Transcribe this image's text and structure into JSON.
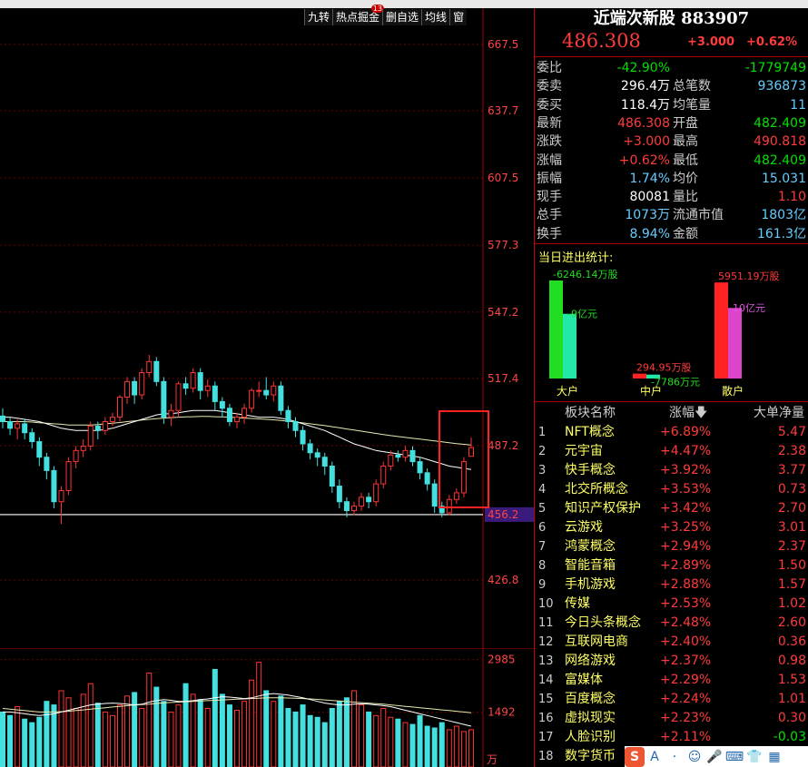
{
  "toolbar": {
    "jiuzhuan": "九转",
    "hotspot": "热点掘金",
    "hotspot_badge": "13",
    "delete_select": "删自选",
    "ma_line": "均线",
    "window": "窗"
  },
  "price_axis": [
    "667.5",
    "637.7",
    "607.5",
    "577.3",
    "547.2",
    "517.4",
    "487.2",
    "456.2",
    "426.8"
  ],
  "volume_axis": [
    "2985",
    "1492"
  ],
  "volume_unit": "万",
  "stock": {
    "name": "近端次新股",
    "code": "883907",
    "price": "486.308",
    "change": "+3.000",
    "pct": "+0.62%"
  },
  "quote_rows": [
    {
      "l1": "委比",
      "v1": "-42.90%",
      "c1": "green",
      "l2": "",
      "v2": "-1779749",
      "c2": "green"
    },
    {
      "l1": "委卖",
      "v1": "296.4万",
      "c1": "white",
      "l2": "总笔数",
      "v2": "936873",
      "c2": "cyan"
    },
    {
      "l1": "委买",
      "v1": "118.4万",
      "c1": "white",
      "l2": "均笔量",
      "v2": "11",
      "c2": "cyan"
    },
    {
      "l1": "最新",
      "v1": "486.308",
      "c1": "red",
      "l2": "开盘",
      "v2": "482.409",
      "c2": "green"
    },
    {
      "l1": "涨跌",
      "v1": "+3.000",
      "c1": "red",
      "l2": "最高",
      "v2": "490.818",
      "c2": "red"
    },
    {
      "l1": "涨幅",
      "v1": "+0.62%",
      "c1": "red",
      "l2": "最低",
      "v2": "482.409",
      "c2": "green"
    },
    {
      "l1": "振幅",
      "v1": "1.74%",
      "c1": "cyan",
      "l2": "均价",
      "v2": "15.031",
      "c2": "cyan"
    },
    {
      "l1": "现手",
      "v1": "80081",
      "c1": "white",
      "l2": "量比",
      "v2": "1.10",
      "c2": "red"
    },
    {
      "l1": "总手",
      "v1": "1073万",
      "c1": "cyan",
      "l2": "流通市值",
      "v2": "1803亿",
      "c2": "cyan"
    },
    {
      "l1": "换手",
      "v1": "8.94%",
      "c1": "cyan",
      "l2": "金额",
      "v2": "161.3亿",
      "c2": "cyan"
    }
  ],
  "flow": {
    "title": "当日进出统计:",
    "groups": [
      {
        "label": "大户",
        "vol_label": "-6246.14万股",
        "amt_label": "-9亿元",
        "vol_frac": 1.0,
        "amt_frac": 0.66,
        "vol_color": "#22dd22",
        "amt_color": "#22e8a8",
        "vol_text_color": "#22dd22",
        "amt_text_color": "#22dd22"
      },
      {
        "label": "中户",
        "vol_label": "294.95万股",
        "amt_label": "-7786万元",
        "vol_frac": 0.05,
        "amt_frac": 0.04,
        "vol_color": "#ff2222",
        "amt_color": "#22e8a8",
        "vol_text_color": "#ff3b3b",
        "amt_text_color": "#22dd22"
      },
      {
        "label": "散户",
        "vol_label": "5951.19万股",
        "amt_label": "10亿元",
        "vol_frac": 0.98,
        "amt_frac": 0.72,
        "vol_color": "#ff2222",
        "amt_color": "#dd44cc",
        "vol_text_color": "#ff3b3b",
        "amt_text_color": "#dd55dd"
      }
    ]
  },
  "sectors": {
    "h_name": "板块名称",
    "h_pct": "涨幅",
    "h_net": "大单净量",
    "rows": [
      {
        "idx": "1",
        "name": "NFT概念",
        "pct": "+6.89%",
        "net": "5.47",
        "neg": false
      },
      {
        "idx": "2",
        "name": "元宇宙",
        "pct": "+4.47%",
        "net": "2.38",
        "neg": false
      },
      {
        "idx": "3",
        "name": "快手概念",
        "pct": "+3.92%",
        "net": "3.77",
        "neg": false
      },
      {
        "idx": "4",
        "name": "北交所概念",
        "pct": "+3.53%",
        "net": "0.73",
        "neg": false
      },
      {
        "idx": "5",
        "name": "知识产权保护",
        "pct": "+3.42%",
        "net": "2.70",
        "neg": false
      },
      {
        "idx": "6",
        "name": "云游戏",
        "pct": "+3.25%",
        "net": "3.01",
        "neg": false
      },
      {
        "idx": "7",
        "name": "鸿蒙概念",
        "pct": "+2.94%",
        "net": "2.37",
        "neg": false
      },
      {
        "idx": "8",
        "name": "智能音箱",
        "pct": "+2.89%",
        "net": "1.50",
        "neg": false
      },
      {
        "idx": "9",
        "name": "手机游戏",
        "pct": "+2.88%",
        "net": "1.57",
        "neg": false
      },
      {
        "idx": "10",
        "name": "传媒",
        "pct": "+2.53%",
        "net": "1.02",
        "neg": false
      },
      {
        "idx": "11",
        "name": "今日头条概念",
        "pct": "+2.48%",
        "net": "2.60",
        "neg": false
      },
      {
        "idx": "12",
        "name": "互联网电商",
        "pct": "+2.40%",
        "net": "0.36",
        "neg": false
      },
      {
        "idx": "13",
        "name": "网络游戏",
        "pct": "+2.37%",
        "net": "0.98",
        "neg": false
      },
      {
        "idx": "14",
        "name": "富媒体",
        "pct": "+2.29%",
        "net": "1.53",
        "neg": false
      },
      {
        "idx": "15",
        "name": "百度概念",
        "pct": "+2.24%",
        "net": "1.01",
        "neg": false
      },
      {
        "idx": "16",
        "name": "虚拟现实",
        "pct": "+2.23%",
        "net": "0.30",
        "neg": false
      },
      {
        "idx": "17",
        "name": "人脸识别",
        "pct": "+2.11%",
        "net": "-0.03",
        "neg": true
      },
      {
        "idx": "18",
        "name": "数字货币",
        "pct": "",
        "net": "",
        "neg": false
      }
    ]
  },
  "ime": {
    "s": "S",
    "a": "A",
    "dot": "·"
  },
  "chart_data": {
    "type": "candlestick",
    "y_ticks": [
      667.5,
      637.7,
      607.5,
      577.3,
      547.2,
      517.4,
      487.2,
      456.2,
      426.8
    ],
    "highlight_level": 456.2,
    "ylim": [
      420.0,
      680.0
    ],
    "candles": [
      [
        500.5,
        498,
        504,
        495
      ],
      [
        498,
        495,
        500,
        492
      ],
      [
        495,
        497,
        499,
        490
      ],
      [
        497,
        493,
        499,
        490
      ],
      [
        493,
        489,
        495,
        486
      ],
      [
        489,
        482,
        491,
        478
      ],
      [
        482,
        476,
        484,
        472
      ],
      [
        476,
        462,
        478,
        459
      ],
      [
        462,
        467,
        469,
        452
      ],
      [
        467,
        480,
        482,
        465
      ],
      [
        480,
        485,
        487,
        477
      ],
      [
        485,
        487,
        490,
        482
      ],
      [
        487,
        496,
        498,
        485
      ],
      [
        496,
        494,
        498,
        490
      ],
      [
        494,
        498,
        500,
        492
      ],
      [
        498,
        500,
        502,
        496
      ],
      [
        500,
        509,
        510,
        498
      ],
      [
        509,
        516,
        518,
        506
      ],
      [
        516,
        510,
        518,
        506
      ],
      [
        510,
        520,
        522,
        508
      ],
      [
        520,
        525,
        528,
        518
      ],
      [
        525,
        516,
        527,
        514
      ],
      [
        516,
        500,
        518,
        497
      ],
      [
        500,
        503,
        506,
        496
      ],
      [
        503,
        515,
        516,
        500
      ],
      [
        515,
        513,
        518,
        510
      ],
      [
        513,
        520,
        522,
        511
      ],
      [
        520,
        512,
        522,
        508
      ],
      [
        512,
        514,
        517,
        509
      ],
      [
        514,
        507,
        516,
        503
      ],
      [
        507,
        504,
        509,
        500
      ],
      [
        504,
        498,
        506,
        496
      ],
      [
        498,
        500,
        502,
        495
      ],
      [
        500,
        504,
        506,
        497
      ],
      [
        504,
        512,
        513,
        502
      ],
      [
        512,
        512,
        516,
        509
      ],
      [
        512,
        510,
        518,
        508
      ],
      [
        510,
        514,
        516,
        507
      ],
      [
        514,
        503,
        516,
        501
      ],
      [
        503,
        498,
        505,
        495
      ],
      [
        498,
        494,
        500,
        491
      ],
      [
        494,
        488,
        496,
        485
      ],
      [
        488,
        484,
        490,
        481
      ],
      [
        484,
        482,
        486,
        478
      ],
      [
        482,
        478,
        484,
        474
      ],
      [
        478,
        469,
        480,
        466
      ],
      [
        469,
        462,
        472,
        459
      ],
      [
        462,
        458,
        464,
        455
      ],
      [
        458,
        460,
        462,
        456
      ],
      [
        460,
        464,
        466,
        458
      ],
      [
        464,
        462,
        466,
        459
      ],
      [
        462,
        470,
        472,
        460
      ],
      [
        470,
        478,
        480,
        468
      ],
      [
        478,
        483,
        485,
        476
      ],
      [
        483,
        482,
        485,
        480
      ],
      [
        482,
        485,
        487,
        480
      ],
      [
        485,
        480,
        487,
        478
      ],
      [
        480,
        475,
        482,
        472
      ],
      [
        475,
        470,
        477,
        467
      ],
      [
        470,
        460,
        472,
        457
      ],
      [
        460,
        457,
        462,
        455
      ],
      [
        457,
        463,
        465,
        456
      ],
      [
        463,
        466,
        468,
        461
      ],
      [
        466,
        480,
        482,
        464
      ],
      [
        482.4,
        486.3,
        490.8,
        482.4
      ]
    ],
    "ma1": [
      500,
      500,
      499.5,
      499,
      498.5,
      498,
      497,
      496,
      495,
      494.5,
      494,
      494,
      494,
      494,
      494.5,
      495,
      496,
      497,
      498,
      499,
      500,
      501,
      501.5,
      501.5,
      502,
      502.5,
      503,
      503,
      503,
      503,
      502.5,
      502,
      501.5,
      501,
      500.5,
      500,
      500,
      500,
      499.5,
      499,
      498,
      497,
      496,
      495,
      494,
      492.5,
      491,
      489.5,
      488,
      487,
      486,
      485,
      484.5,
      484,
      483.5,
      483,
      482.5,
      482,
      481,
      480,
      479,
      478,
      477.5,
      477,
      476.5
    ],
    "ma2": [
      498,
      498,
      498,
      498,
      497.8,
      497.5,
      497.3,
      497,
      496.8,
      496.5,
      496.5,
      496.5,
      496.5,
      496.7,
      497,
      497.3,
      497.6,
      498,
      498.3,
      498.7,
      499,
      499.3,
      499.6,
      499.8,
      500,
      500.1,
      500.2,
      500.3,
      500.3,
      500.2,
      500.1,
      500,
      499.8,
      499.6,
      499.4,
      499.2,
      499,
      498.8,
      498.5,
      498.2,
      497.8,
      497.4,
      497,
      496.6,
      496.2,
      495.7,
      495.2,
      494.7,
      494.2,
      493.7,
      493.2,
      492.7,
      492.2,
      491.7,
      491.3,
      490.9,
      490.5,
      490.1,
      489.7,
      489.3,
      488.9,
      488.5,
      488.1,
      487.8,
      487.5
    ],
    "volume": {
      "ylim": [
        0,
        3200
      ],
      "values": [
        1500,
        1400,
        1650,
        1300,
        1200,
        1350,
        1800,
        1700,
        2100,
        1900,
        1600,
        2000,
        2300,
        1750,
        1500,
        1400,
        1700,
        1950,
        2050,
        1600,
        2600,
        2200,
        1800,
        1500,
        1700,
        2300,
        2000,
        1850,
        1600,
        2700,
        2000,
        1700,
        1550,
        1800,
        2400,
        2900,
        2100,
        1800,
        1950,
        1600,
        1500,
        1700,
        1400,
        1350,
        1200,
        1600,
        1800,
        1900,
        2100,
        1700,
        1500,
        1400,
        1600,
        1350,
        1300,
        1200,
        1150,
        1400,
        1100,
        1050,
        1200,
        1000,
        1100,
        950,
        1000
      ],
      "ma1": [
        1500,
        1500,
        1480,
        1450,
        1420,
        1400,
        1420,
        1450,
        1500,
        1550,
        1600,
        1650,
        1700,
        1720,
        1740,
        1750,
        1740,
        1720,
        1700,
        1720,
        1780,
        1820,
        1850,
        1830,
        1800,
        1800,
        1820,
        1850,
        1870,
        1900,
        1930,
        1920,
        1900,
        1880,
        1900,
        1950,
        2000,
        2020,
        2000,
        1980,
        1940,
        1900,
        1850,
        1800,
        1750,
        1720,
        1700,
        1700,
        1720,
        1730,
        1720,
        1700,
        1680,
        1650,
        1600,
        1550,
        1500,
        1450,
        1400,
        1350,
        1300,
        1250,
        1200,
        1150,
        1100
      ],
      "ma2": [
        1600,
        1580,
        1560,
        1540,
        1520,
        1500,
        1500,
        1500,
        1510,
        1520,
        1540,
        1560,
        1580,
        1600,
        1620,
        1640,
        1660,
        1680,
        1700,
        1710,
        1720,
        1740,
        1760,
        1770,
        1780,
        1790,
        1800,
        1810,
        1820,
        1830,
        1840,
        1850,
        1860,
        1870,
        1880,
        1890,
        1900,
        1900,
        1900,
        1895,
        1890,
        1880,
        1870,
        1855,
        1840,
        1825,
        1810,
        1795,
        1780,
        1765,
        1750,
        1735,
        1720,
        1700,
        1680,
        1660,
        1640,
        1620,
        1600,
        1580,
        1560,
        1540,
        1520,
        1500,
        1480
      ]
    }
  }
}
